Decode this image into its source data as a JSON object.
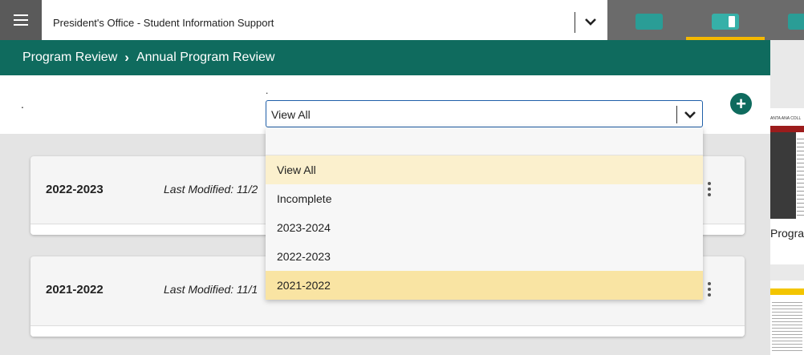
{
  "header": {
    "app_title": "President's Office - Student Information Support"
  },
  "breadcrumb": {
    "parent": "Program Review",
    "current": "Annual Program Review"
  },
  "filter": {
    "left_label": ".",
    "select_label": ".",
    "selected_value": "View All",
    "options": [
      "View All",
      "Incomplete",
      "2023-2024",
      "2022-2023",
      "2021-2022"
    ],
    "highlighted_option": "2021-2022"
  },
  "cards": [
    {
      "year": "2022-2023",
      "last_modified": "Last Modified: 11/2"
    },
    {
      "year": "2021-2022",
      "last_modified": "Last Modified: 11/1"
    }
  ],
  "side_preview": {
    "thumb1_header": "ANTA ANA COLL",
    "thumb1_caption": "Progra"
  },
  "colors": {
    "brand_green": "#0f6b5e",
    "active_tab": "#f5b800",
    "selected_option": "#fbf0cd",
    "hover_option": "#f9e4a3"
  }
}
